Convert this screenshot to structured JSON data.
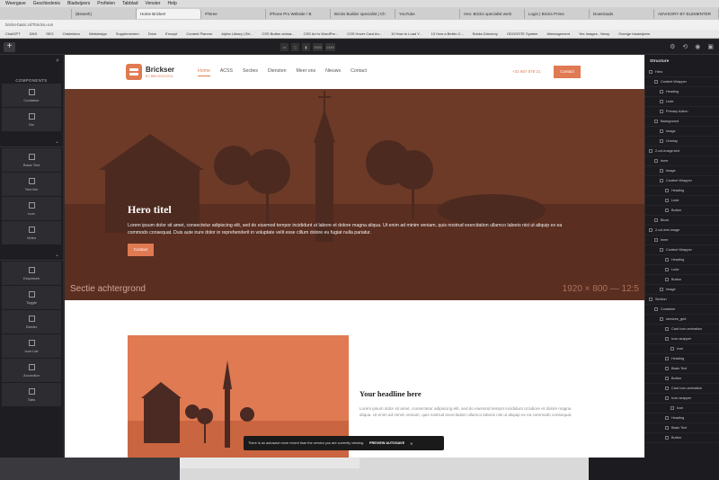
{
  "browser": {
    "menu": [
      "Weergave",
      "Geschiedenis",
      "Bladwijzers",
      "Profielen",
      "Tabblad",
      "Venster",
      "Help"
    ],
    "tabs": [
      "",
      "(Bewerk)",
      "Home Bricker!",
      "#Teree",
      "iPhone Pro Website / B",
      "Bricks Builder specialist | Ch",
      "YouTube",
      "Hex: Bricks specialist werk",
      "Login | Bricks Prime",
      "Downloads",
      "ADVISORY BY ELEMENTER"
    ],
    "address": "bricks-basic.nl/?bricks=run",
    "bookmarks": [
      "ChatGPT",
      "DNS",
      "SEO",
      "Ontdekken",
      "Webdesign",
      "Supplementen",
      "Drive",
      "Envoyé",
      "Content Planner",
      "Alpha Library | Bri...",
      "CSS Button anima...",
      "CSS Art in WordPre...",
      "CSS Hover Card An...",
      "10 How to Load Y...",
      "10 How a Better-C...",
      "Bricks Directory",
      "ODOOSTE System",
      "Allemagement",
      "Yes Images - Newy",
      "Overige bladwijzers"
    ]
  },
  "builder_toolbar": {
    "add_label": "+",
    "width_value": "1920",
    "height_value": "1440"
  },
  "left_panel": {
    "title": "COMPONENTS",
    "elements": [
      "Container",
      "Div",
      "Basic Text",
      "Text link",
      "Icon",
      "Video",
      "Dropdown",
      "Toggle",
      "Divider",
      "Icon List",
      "Accordion",
      "Tabs"
    ]
  },
  "site": {
    "brand_name": "Brickser",
    "brand_tagline": "BY BRICKSCHOOL",
    "nav": [
      "Home",
      "ACSS",
      "Secties",
      "Diensten",
      "Meer ons",
      "Nieuws",
      "Contact"
    ],
    "phone": "+31 667 879 21",
    "cta": "Contact",
    "hero_title": "Hero titel",
    "hero_text": "Lorem ipsum dolor sit amet, consectetur adipiscing elit, sed do eiusmod tempor incididunt ut labore et dolore magna aliqua. Ut enim ad minim veniam, quis nostrud exercitation ullamco laboris nisi ut aliquip ex ea commodo consequat. Duis aute irure dolor in reprehenderit in voluptate velit esse cillum dolore eu fugiat nulla pariatur.",
    "hero_button": "Contact",
    "hero_caption": "Sectie achtergrond",
    "hero_dimensions": "1920 × 800 — 12:5",
    "headline": "Your headline here",
    "paragraph": "Lorem ipsum dolor sit amet, consectetur adipiscing elit, sed do eiusmod tempor incididunt ut labore et dolore magna aliqua. Ut enim ad minim veniam, quis nostrud exercitation ullamco laboris nisi ut aliquip ex ea commodo consequat."
  },
  "toast": {
    "message": "There is an autosave more recent than the version you are currently viewing.",
    "action": "PREVIEW AUTOSAVE",
    "close": "✕"
  },
  "structure": {
    "title": "Structure",
    "rows": [
      {
        "label": "Hero",
        "depth": 0
      },
      {
        "label": "Content Wrapper",
        "depth": 1
      },
      {
        "label": "Heading",
        "depth": 2
      },
      {
        "label": "Lede",
        "depth": 2
      },
      {
        "label": "Primary Action",
        "depth": 2
      },
      {
        "label": "Background",
        "depth": 1
      },
      {
        "label": "Image",
        "depth": 2
      },
      {
        "label": "Overlay",
        "depth": 2
      },
      {
        "label": "2-col-image-text",
        "depth": 0
      },
      {
        "label": "Inner",
        "depth": 1
      },
      {
        "label": "Image",
        "depth": 2
      },
      {
        "label": "Content Wrapper",
        "depth": 2
      },
      {
        "label": "Heading",
        "depth": 3
      },
      {
        "label": "Lede",
        "depth": 3
      },
      {
        "label": "Button",
        "depth": 3
      },
      {
        "label": "Block",
        "depth": 1
      },
      {
        "label": "2-col-text-image",
        "depth": 0
      },
      {
        "label": "Inner",
        "depth": 1
      },
      {
        "label": "Content Wrapper",
        "depth": 2
      },
      {
        "label": "Heading",
        "depth": 3
      },
      {
        "label": "Lede",
        "depth": 3
      },
      {
        "label": "Button",
        "depth": 3
      },
      {
        "label": "Image",
        "depth": 2
      },
      {
        "label": "Section",
        "depth": 0
      },
      {
        "label": "Container",
        "depth": 1
      },
      {
        "label": "services_grid",
        "depth": 2
      },
      {
        "label": "Card Icon animation",
        "depth": 3
      },
      {
        "label": "Icon-wrapper",
        "depth": 3
      },
      {
        "label": "Icon",
        "depth": 4
      },
      {
        "label": "Heading",
        "depth": 3
      },
      {
        "label": "Basic Text",
        "depth": 3
      },
      {
        "label": "Button",
        "depth": 3
      },
      {
        "label": "Card Icon animation",
        "depth": 3
      },
      {
        "label": "Icon-wrapper",
        "depth": 3
      },
      {
        "label": "Icon",
        "depth": 4
      },
      {
        "label": "Heading",
        "depth": 3
      },
      {
        "label": "Basic Text",
        "depth": 3
      },
      {
        "label": "Button",
        "depth": 3
      }
    ]
  },
  "colors": {
    "accent": "#e07a52",
    "hero_overlay": "#6d3a28",
    "builder_dark": "#1e1e22"
  }
}
